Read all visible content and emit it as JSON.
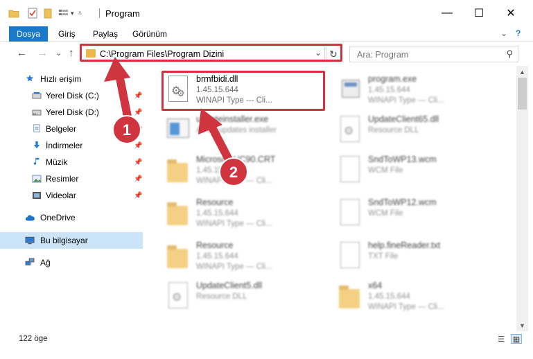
{
  "window": {
    "title": "Program",
    "minimize_symbol": "—",
    "maximize_symbol": "☐",
    "close_symbol": "✕"
  },
  "ribbon": {
    "tabs": [
      "Dosya",
      "Giriş",
      "Paylaş",
      "Görünüm"
    ],
    "expand_symbol": "⌄",
    "help_symbol": "?"
  },
  "navigation": {
    "back_symbol": "←",
    "forward_symbol": "→",
    "recent_symbol": "⌄",
    "up_symbol": "↑",
    "address_path": "C:\\Program Files\\Program Dizini",
    "address_dropdown_symbol": "⌄",
    "refresh_symbol": "↻",
    "search_placeholder": "Ara: Program",
    "search_symbol": "⚲"
  },
  "sidebar": {
    "quick_access": "Hızlı erişim",
    "pinned_items": [
      {
        "label": "Yerel Disk (C:)"
      },
      {
        "label": "Yerel Disk (D:)"
      },
      {
        "label": "Belgeler"
      },
      {
        "label": "İndirmeler"
      },
      {
        "label": "Müzik"
      },
      {
        "label": "Resimler"
      },
      {
        "label": "Videolar"
      }
    ],
    "pin_symbol": "📌",
    "onedrive": "OneDrive",
    "this_pc": "Bu bilgisayar",
    "network": "Ağ"
  },
  "files": [
    {
      "name": "brmfbidi.dll",
      "version": "1.45.15.644",
      "type": "WINAPI Type --- Cli...",
      "icon": "dll-gear-icon"
    },
    {
      "name": "program.exe",
      "version": "1.45.15.644",
      "type": "WINAPI Type --- Cli...",
      "icon": "exe-icon"
    },
    {
      "name": "updateinstaller.exe",
      "version": "",
      "type": "AVTY updates installer",
      "icon": "installer-icon"
    },
    {
      "name": "UpdateClient65.dll",
      "version": "",
      "type": "Resource DLL",
      "icon": "dll-gear-icon"
    },
    {
      "name": "Microsoft.VC90.CRT",
      "version": "1.45.15.644",
      "type": "WINAPI Type --- Cli...",
      "icon": "folder-icon"
    },
    {
      "name": "SndToWP13.wcm",
      "version": "",
      "type": "WCM File",
      "icon": "document-icon"
    },
    {
      "name": "Resource",
      "version": "1.45.15.644",
      "type": "WINAPI Type --- Cli...",
      "icon": "folder-icon"
    },
    {
      "name": "SndToWP12.wcm",
      "version": "",
      "type": "WCM File",
      "icon": "document-icon"
    },
    {
      "name": "Resource",
      "version": "1.45.15.644",
      "type": "WINAPI Type --- Cli...",
      "icon": "folder-icon"
    },
    {
      "name": "help.fineReader.txt",
      "version": "",
      "type": "TXT File",
      "icon": "document-icon"
    },
    {
      "name": "UpdateClient5.dll",
      "version": "",
      "type": "Resource DLL",
      "icon": "dll-gear-icon"
    },
    {
      "name": "x64",
      "version": "1.45.15.644",
      "type": "WINAPI Type --- Cli...",
      "icon": "folder-icon"
    }
  ],
  "status": {
    "item_count": "122 öge"
  },
  "annotations": {
    "step1": "1",
    "step2": "2",
    "highlight_color": "#d0343f",
    "badge_color": "#d0343f"
  },
  "colors": {
    "accent": "#1979ca",
    "selected_bg": "#cce4f7",
    "folder": "#efc15a"
  }
}
